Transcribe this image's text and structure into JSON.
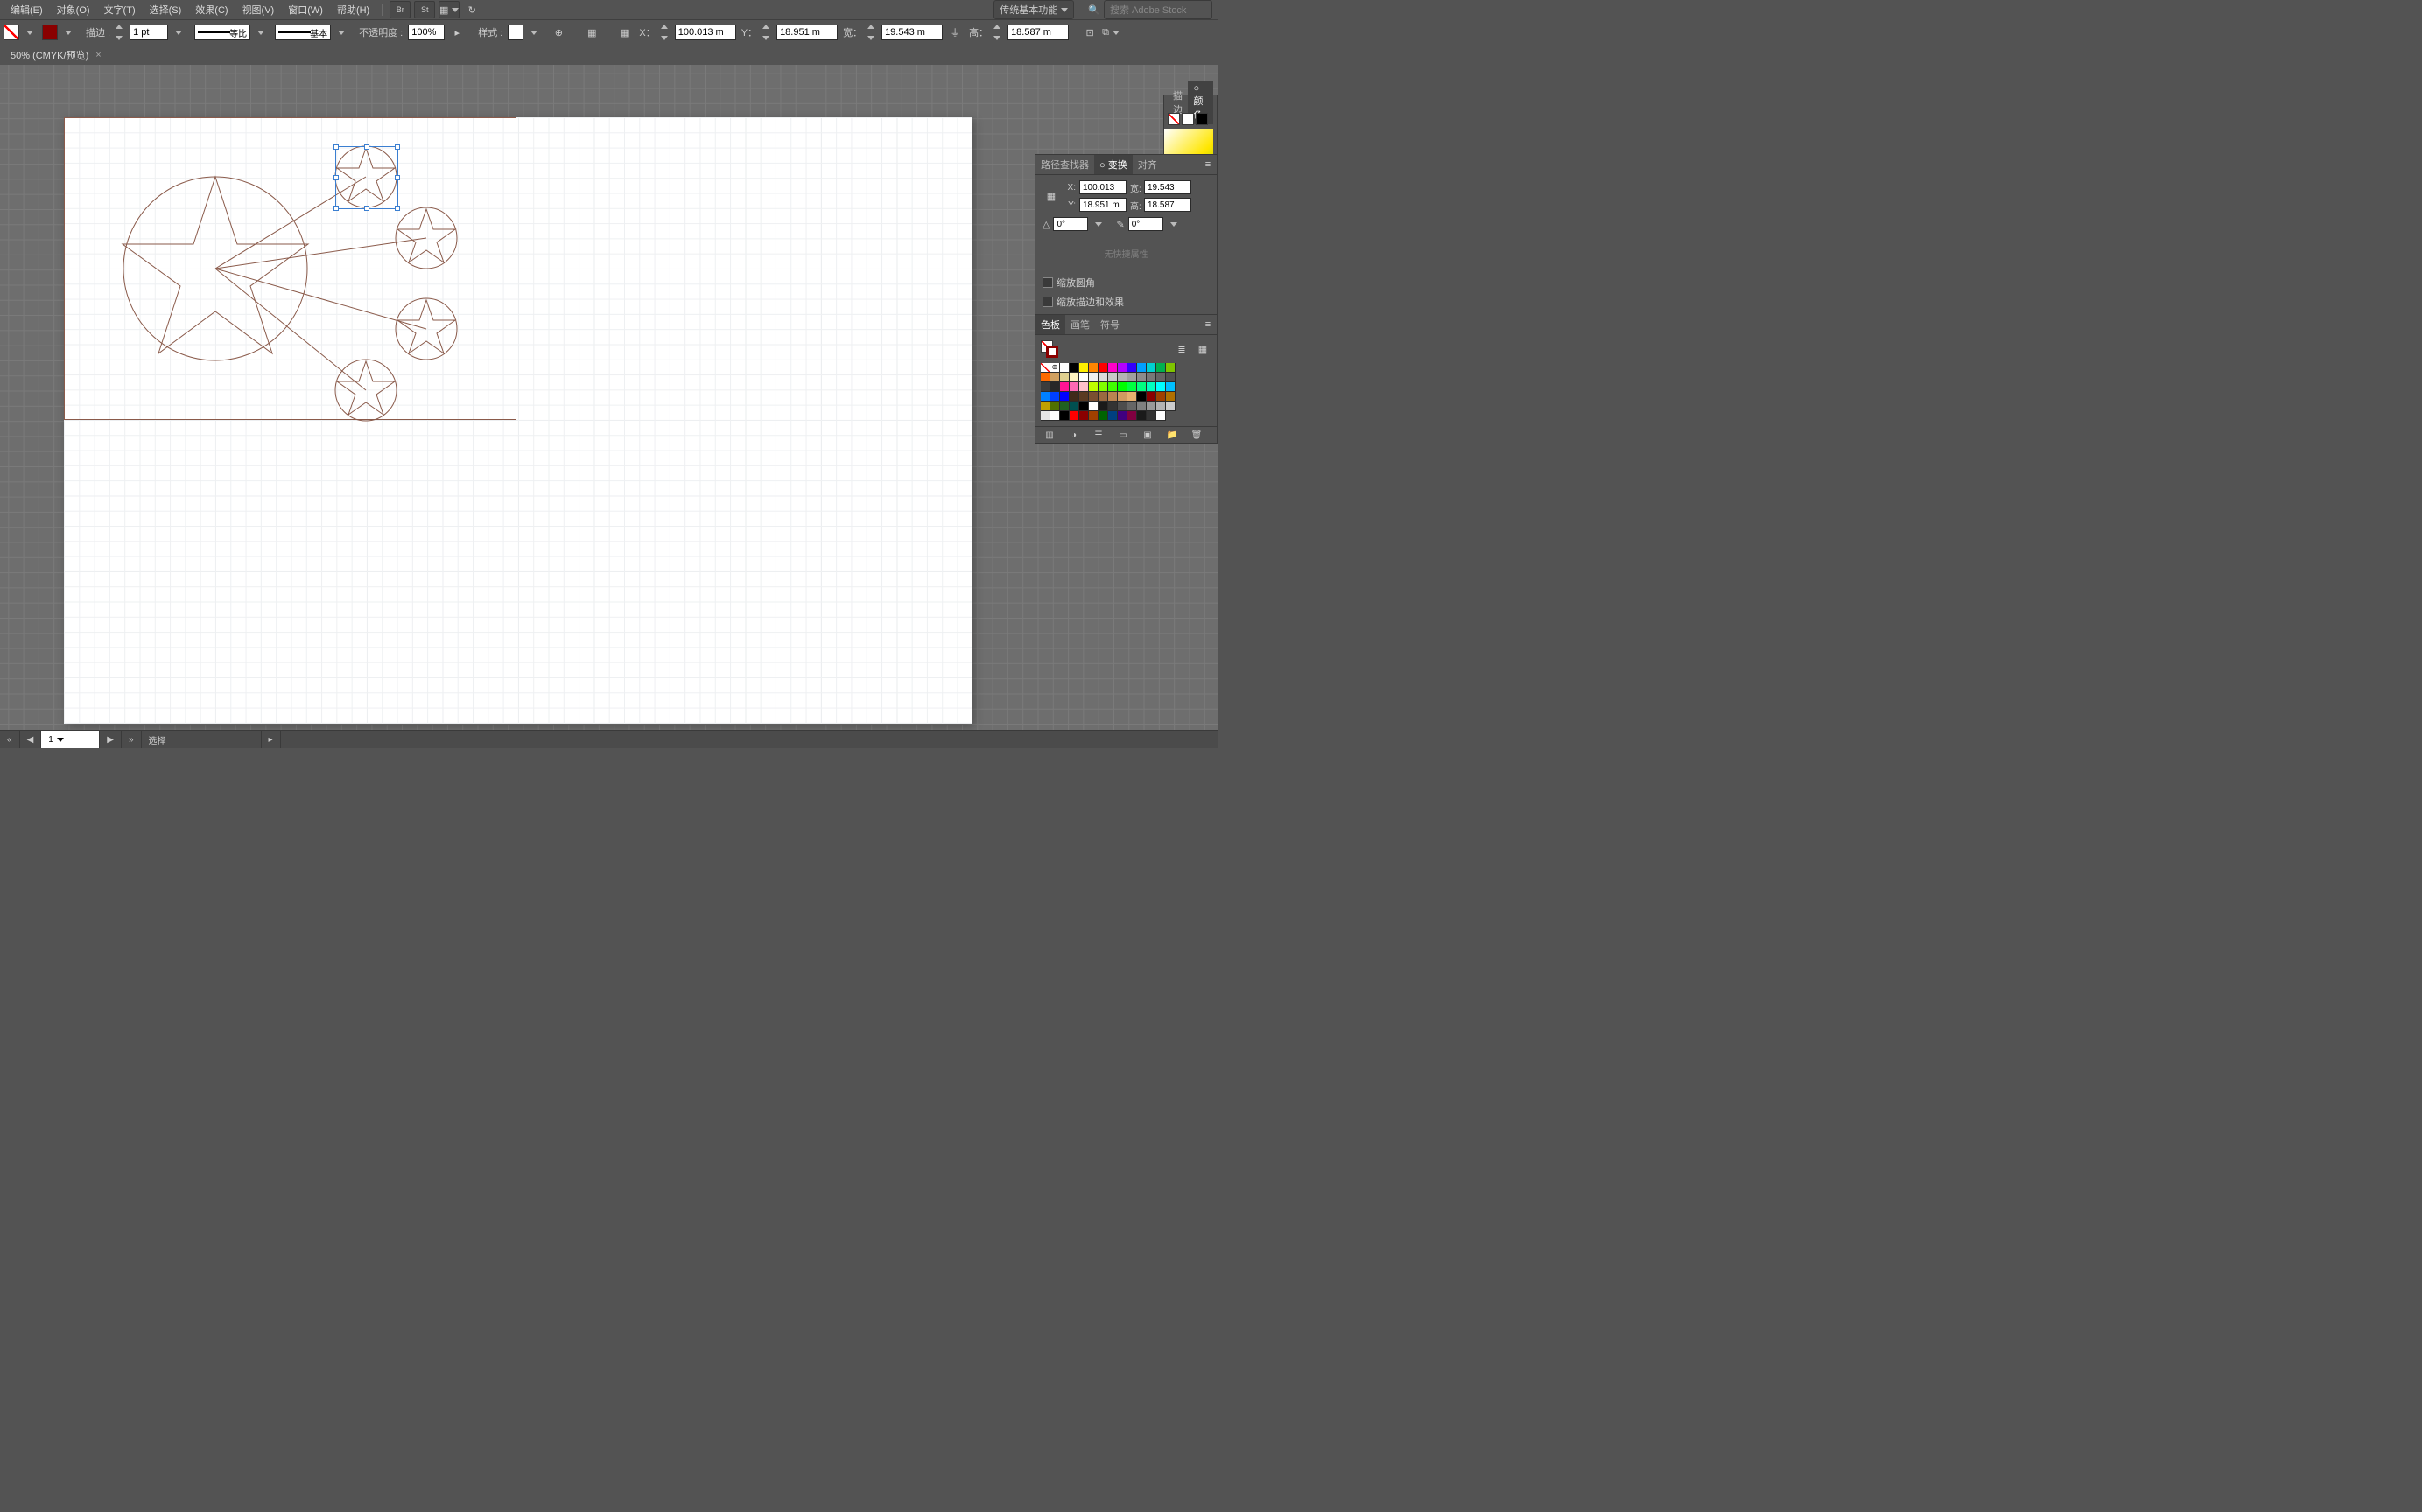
{
  "menu": {
    "edit": "编辑(E)",
    "object": "对象(O)",
    "type": "文字(T)",
    "select": "选择(S)",
    "effect": "效果(C)",
    "view": "视图(V)",
    "window": "窗口(W)",
    "help": "帮助(H)"
  },
  "workspace": "传统基本功能",
  "search": {
    "placeholder": "搜索 Adobe Stock"
  },
  "control": {
    "stroke_lbl": "描边 :",
    "stroke_weight": "1 pt",
    "stroke_style1": "等比",
    "stroke_style2": "基本",
    "opacity_lbl": "不透明度 :",
    "opacity": "100%",
    "style_lbl": "样式 :",
    "x_lbl": "X：",
    "x": "100.013 m",
    "y_lbl": "Y：",
    "y": "18.951 m",
    "w_lbl": "宽：",
    "w": "19.543 m",
    "h_lbl": "高：",
    "h": "18.587 m"
  },
  "doc": {
    "tab": "50% (CMYK/预览)",
    "close": "×"
  },
  "status": {
    "page_value": "1",
    "tool": "选择",
    "nav_prev": "◀",
    "nav_next": "▶",
    "nav_first": "«",
    "nav_last": "»"
  },
  "panel": {
    "tab_path": "路径查找器",
    "tab_transform": "○ 变换",
    "tab_align": "对齐",
    "x_lbl": "X:",
    "x": "100.013 ",
    "y_lbl": "Y:",
    "y": "18.951 m",
    "w_lbl": "宽:",
    "w": "19.543",
    "h_lbl": "高:",
    "h": "18.587",
    "rotate_lbl": "△",
    "rotate": "0°",
    "shear_lbl": "✎",
    "shear": "0°",
    "noquick": "无快捷属性",
    "chk_corner": "缩放圆角",
    "chk_stroke": "缩放描边和效果",
    "sw_tab1": "色板",
    "sw_tab2": "画笔",
    "sw_tab3": "符号"
  },
  "strip": {
    "tab1": "描边",
    "tab2": "○ 颜色"
  },
  "swatch_colors": [
    "none",
    "reg",
    "#ffffff",
    "#000000",
    "#ffee00",
    "#ff8500",
    "#ff0000",
    "#ff00c8",
    "#b400ff",
    "#3300ff",
    "#00a0ff",
    "#00d0d0",
    "#00b050",
    "#7fc400",
    "#ff6a00",
    "#d0a060",
    "#e0d090",
    "#fff4c0",
    "#fff",
    "#f0f0f0",
    "#dcdcdc",
    "#c8c8c8",
    "#b4b4b4",
    "#a0a0a0",
    "#8c8c8c",
    "#787878",
    "#646464",
    "#505050",
    "#3c3c3c",
    "#282828",
    "#ff1493",
    "#ff69b4",
    "#ffc0cb",
    "#bfff00",
    "#80ff00",
    "#40ff00",
    "#00ff00",
    "#00ff40",
    "#00ff80",
    "#00ffbf",
    "#00ffff",
    "#00bfff",
    "#0080ff",
    "#0040ff",
    "#0000ff",
    "#3f2a1a",
    "#5a3a22",
    "#7a5030",
    "#9a6a40",
    "#ba8450",
    "#d09a60",
    "#e6b070",
    "#000",
    "#8a0000",
    "#a04000",
    "#b07000",
    "#c0a000",
    "#507000",
    "#206020",
    "#005050",
    "#000",
    "#fff",
    "#1a1a1a",
    "#333",
    "#4d4d4d",
    "#666",
    "#808080",
    "#999",
    "#b3b3b3",
    "#ccc",
    "#e6e6e6",
    "#fff",
    "#000",
    "#f00",
    "#8a0000",
    "#a04000",
    "#006400",
    "#004080",
    "#400080",
    "#800040",
    "#1a1a1a",
    "#333",
    "#fff"
  ]
}
